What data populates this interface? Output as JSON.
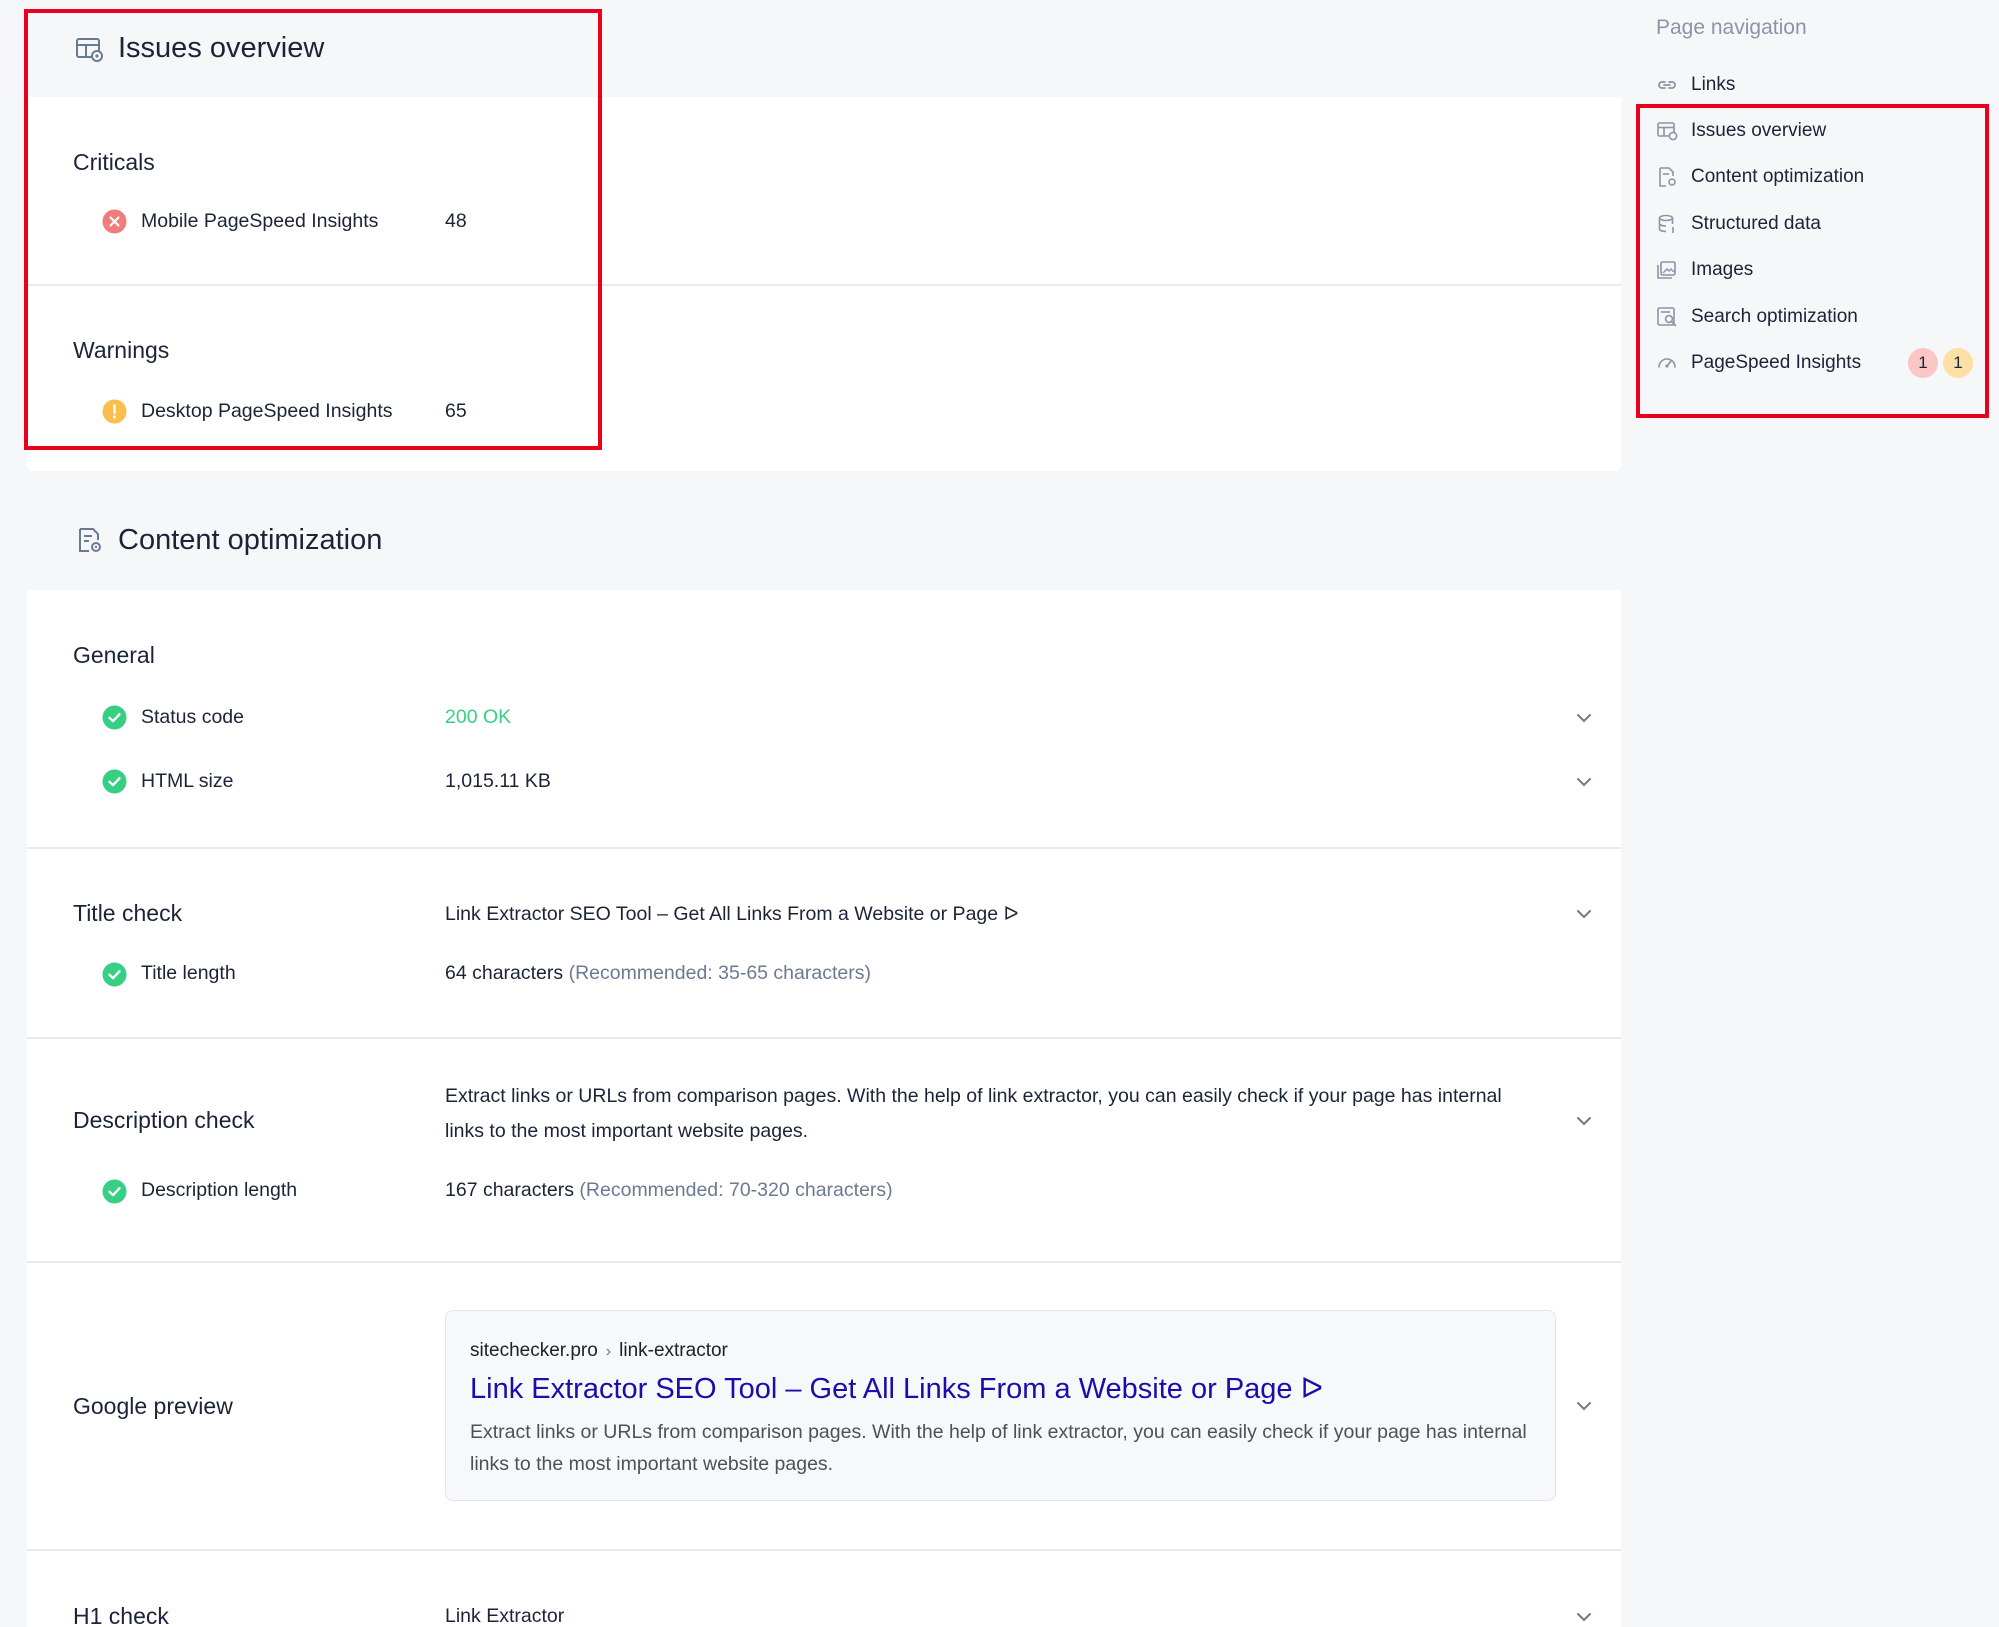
{
  "issues_overview": {
    "title": "Issues overview",
    "criticals": {
      "heading": "Criticals",
      "label": "Mobile PageSpeed Insights",
      "value": "48"
    },
    "warnings": {
      "heading": "Warnings",
      "label": "Desktop PageSpeed Insights",
      "value": "65"
    }
  },
  "content_optimization": {
    "title": "Content optimization",
    "general": {
      "heading": "General",
      "status_code_label": "Status code",
      "status_code_value": "200 OK",
      "html_size_label": "HTML size",
      "html_size_value": "1,015.11 KB"
    },
    "title_check": {
      "heading": "Title check",
      "value": "Link Extractor SEO Tool – Get All Links From a Website or Page ᐅ",
      "length_label": "Title length",
      "length_value": "64 characters",
      "length_hint": "(Recommended: 35-65 characters)"
    },
    "description_check": {
      "heading": "Description check",
      "value": "Extract links or URLs from comparison pages. With the help of link extractor, you can easily check if your page has internal links to the most important website pages.",
      "length_label": "Description length",
      "length_value": "167 characters",
      "length_hint": "(Recommended: 70-320 characters)"
    },
    "google_preview": {
      "heading": "Google preview",
      "domain": "sitechecker.pro",
      "separator": "›",
      "path": "link-extractor",
      "title": "Link Extractor SEO Tool – Get All Links From a Website or Page ᐅ",
      "description": "Extract links or URLs from comparison pages. With the help of link extractor, you can easily check if your page has internal links to the most important website pages."
    },
    "h1_check": {
      "heading": "H1 check",
      "value": "Link Extractor"
    }
  },
  "page_navigation": {
    "heading": "Page navigation",
    "items": [
      {
        "label": "Links",
        "icon": "link-icon"
      },
      {
        "label": "Issues overview",
        "icon": "issues-icon"
      },
      {
        "label": "Content optimization",
        "icon": "content-icon"
      },
      {
        "label": "Structured data",
        "icon": "database-icon"
      },
      {
        "label": "Images",
        "icon": "image-icon"
      },
      {
        "label": "Search optimization",
        "icon": "search-doc-icon"
      },
      {
        "label": "PageSpeed Insights",
        "icon": "speedometer-icon"
      }
    ],
    "pagespeed_badges": {
      "critical": "1",
      "warning": "1"
    }
  },
  "colors": {
    "critical": "#f07c7c",
    "warning": "#f9be4d",
    "ok": "#36cf83",
    "highlight": "#e8001c"
  }
}
